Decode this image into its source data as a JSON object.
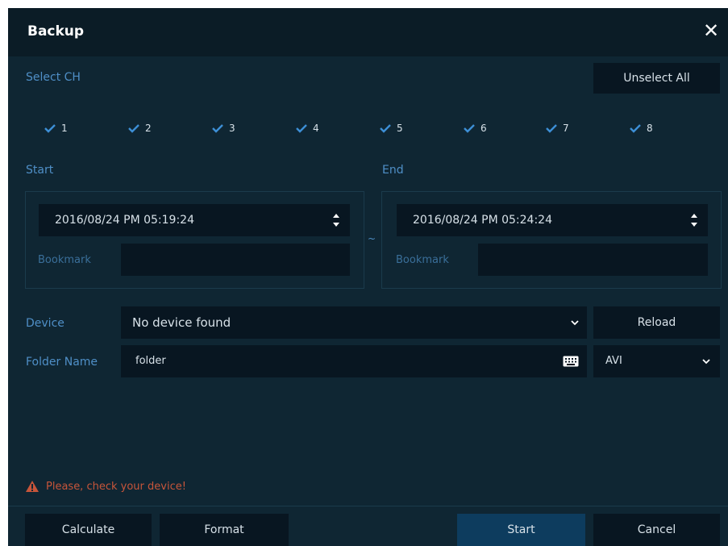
{
  "dialog": {
    "title": "Backup",
    "close_label": "✕"
  },
  "select_ch": {
    "label": "Select CH",
    "unselect_all_label": "Unselect All",
    "channels": [
      {
        "label": "1",
        "checked": true
      },
      {
        "label": "2",
        "checked": true
      },
      {
        "label": "3",
        "checked": true
      },
      {
        "label": "4",
        "checked": true
      },
      {
        "label": "5",
        "checked": true
      },
      {
        "label": "6",
        "checked": true
      },
      {
        "label": "7",
        "checked": true
      },
      {
        "label": "8",
        "checked": true
      }
    ]
  },
  "start": {
    "label": "Start",
    "datetime": "2016/08/24 PM 05:19:24",
    "bookmark_label": "Bookmark",
    "bookmark_value": ""
  },
  "end": {
    "label": "End",
    "datetime": "2016/08/24 PM 05:24:24",
    "bookmark_label": "Bookmark",
    "bookmark_value": ""
  },
  "range_separator": "~",
  "device": {
    "label": "Device",
    "value": "No device found",
    "reload_label": "Reload"
  },
  "folder": {
    "label": "Folder Name",
    "value": "folder",
    "format_value": "AVI"
  },
  "warning": {
    "text": "Please, check your device!"
  },
  "buttons": {
    "calculate": "Calculate",
    "format": "Format",
    "start": "Start",
    "cancel": "Cancel"
  },
  "icons": {
    "close": "close-icon",
    "check": "check-icon",
    "spinner": "up-down-spinner-icon",
    "chevron": "chevron-down-icon",
    "keyboard": "keyboard-icon",
    "warning": "warning-icon"
  },
  "colors": {
    "background": "#0f2633",
    "titlebar": "#0b1c26",
    "field": "#081621",
    "label": "#4f8fc7",
    "check": "#3d8fd6",
    "warning": "#c7553a",
    "primary_button": "#0d3c5e"
  }
}
